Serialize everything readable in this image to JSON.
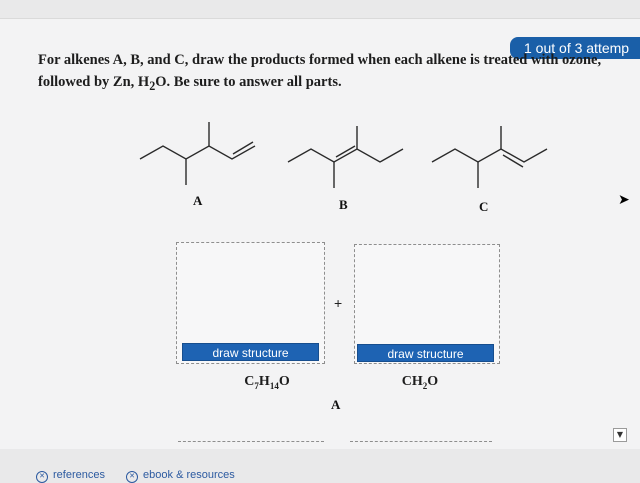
{
  "attempt_badge": "1 out of 3 attemp",
  "question": {
    "part1": "For alkenes A, B, and C, draw the products formed when each alkene is treated with ozone, followed by Zn, H",
    "sub2": "2",
    "part2": "O. Be sure to answer all parts."
  },
  "molecules": [
    {
      "label": "A"
    },
    {
      "label": "B"
    },
    {
      "label": "C"
    }
  ],
  "answers": [
    {
      "button_label": "draw structure",
      "formula": {
        "c": "C",
        "c_sub": "7",
        "h": "H",
        "h_sub": "14",
        "o": "O"
      }
    },
    {
      "button_label": "draw structure",
      "formula": {
        "c": "CH",
        "c_sub": "2",
        "o": "O"
      }
    }
  ],
  "plus_sign": "+",
  "reaction_label": "A",
  "footer": {
    "references": "references",
    "ebook": "ebook & resources"
  },
  "colors": {
    "accent_blue": "#1e63b3",
    "badge_blue": "#1a5fa8"
  }
}
